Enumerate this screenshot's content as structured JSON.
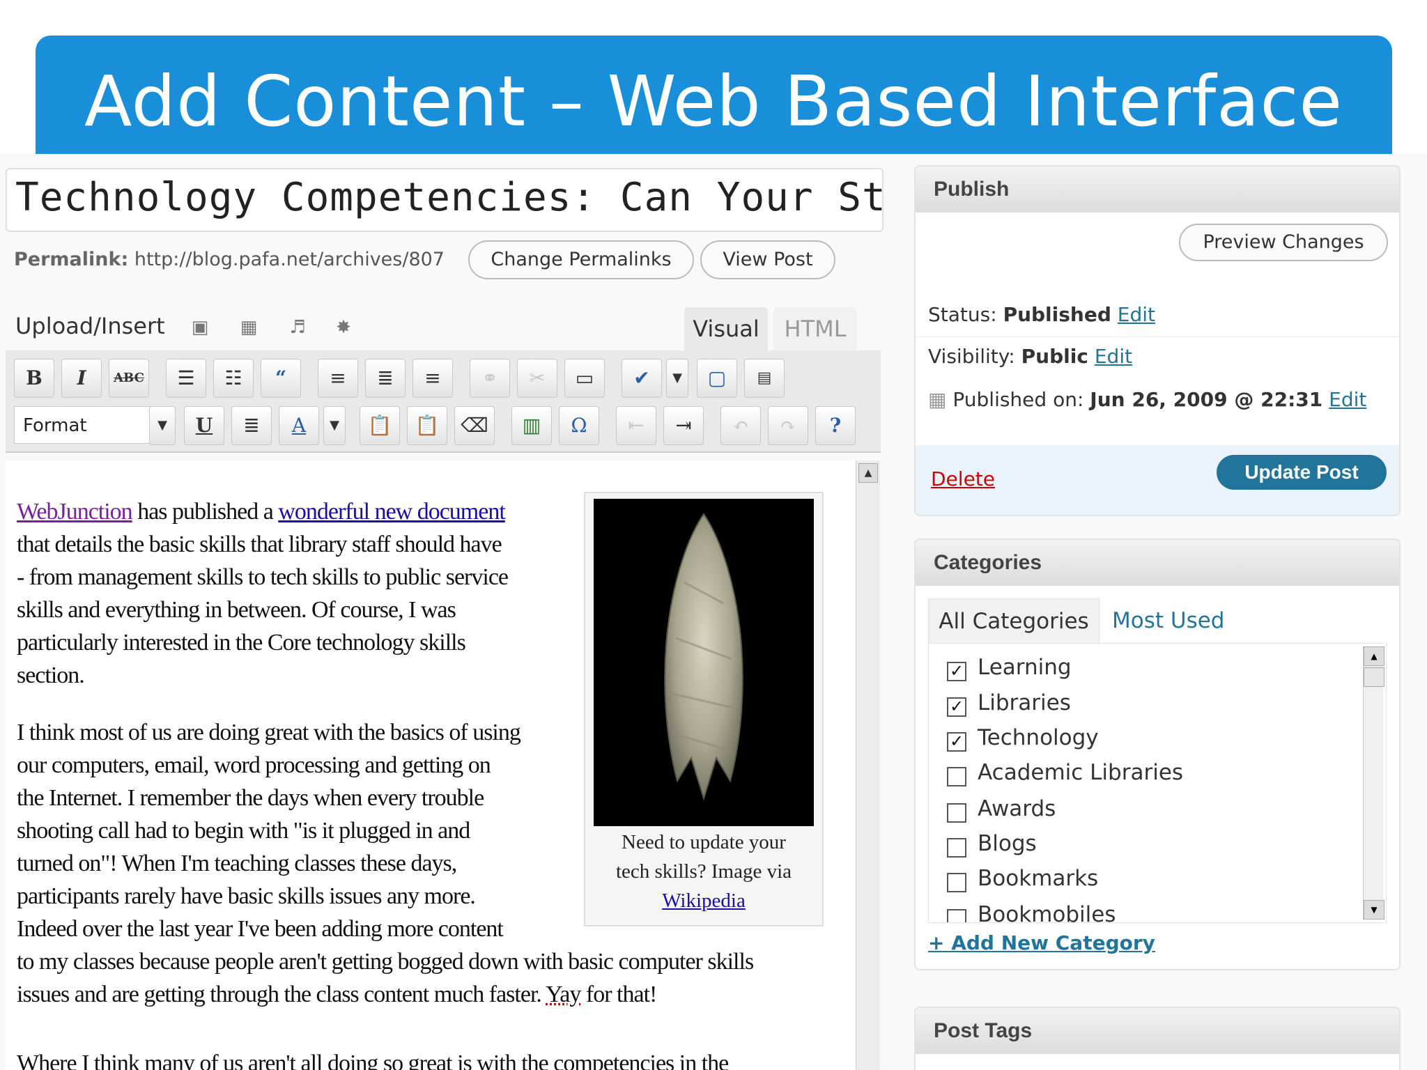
{
  "slide": {
    "title": "Add Content – Web Based Interface"
  },
  "editor": {
    "post_title": "Technology Competencies: Can Your Staff D",
    "permalink_label": "Permalink:",
    "permalink_url": "http://blog.pafa.net/archives/807",
    "change_permalinks": "Change Permalinks",
    "view_post": "View Post",
    "upload_insert": "Upload/Insert",
    "tab_visual": "Visual",
    "tab_html": "HTML",
    "format_label": "Format",
    "p1_link1": "WebJunction",
    "p1_a": " has published a ",
    "p1_link2": "wonderful new document",
    "p1_l2": "that details the basic skills that library staff should have",
    "p1_l3": "- from management skills to tech skills to public service",
    "p1_l4": "skills and everything in between. Of course,  I was",
    "p1_l5": "particularly interested in the Core technology skills",
    "p1_l6": "section.",
    "p2_l1": "I think most of us are doing great with the basics of using",
    "p2_l2": "our computers, email, word processing and getting on",
    "p2_l3": "the Internet. I remember the days when every trouble",
    "p2_l4": "shooting call had to begin with \"is it plugged in and",
    "p2_l5": "turned on\"!  When I'm teaching classes these days,",
    "p2_l6": "participants rarely have basic skills issues any more.",
    "p2_l7": "Indeed over the last year I've been adding more content",
    "p2_l8": "to my classes because people aren't getting bogged down with basic computer skills",
    "p2_l9a": "issues and are getting through the class content much faster. ",
    "p2_l9b": "Yay",
    "p2_l9c": " for that!",
    "p3_l1": "Where I think many of us aren't all doing so great is with the competencies in the",
    "caption_l1": "Need to update your",
    "caption_l2": "tech skills?  Image via",
    "caption_link": "Wikipedia"
  },
  "publish": {
    "heading": "Publish",
    "preview": "Preview Changes",
    "status_label": "Status:",
    "status_value": "Published",
    "edit": "Edit",
    "visibility_label": "Visibility:",
    "visibility_value": "Public",
    "published_on_label": "Published on:",
    "published_on_value": "Jun 26, 2009 @ 22:31",
    "delete": "Delete",
    "update": "Update Post"
  },
  "categories": {
    "heading": "Categories",
    "tab_all": "All Categories",
    "tab_most_used": "Most Used",
    "items": [
      {
        "label": "Learning",
        "checked": true
      },
      {
        "label": "Libraries",
        "checked": true
      },
      {
        "label": "Technology",
        "checked": true
      },
      {
        "label": "Academic Libraries",
        "checked": false
      },
      {
        "label": "Awards",
        "checked": false
      },
      {
        "label": "Blogs",
        "checked": false
      },
      {
        "label": "Bookmarks",
        "checked": false
      },
      {
        "label": "Bookmobiles",
        "checked": false
      }
    ],
    "add_new": "+ Add New Category"
  },
  "post_tags": {
    "heading": "Post Tags"
  },
  "colors": {
    "banner": "#1a8fd9",
    "link": "#21759b",
    "update_button": "#21759b",
    "delete": "#d00000"
  }
}
